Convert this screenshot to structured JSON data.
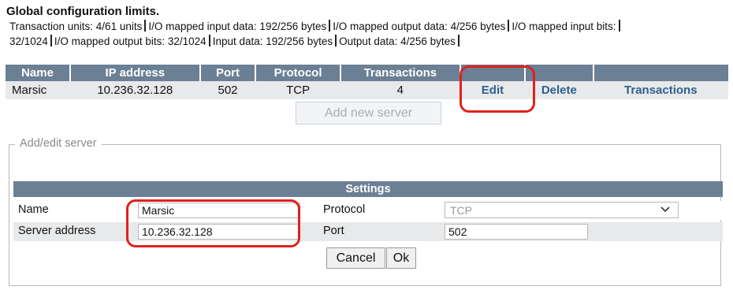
{
  "limits": {
    "title": "Global configuration limits.",
    "segments": [
      "Transaction units: 4/61 units",
      "I/O mapped input data: 192/256 bytes",
      "I/O mapped output data: 4/256 bytes",
      "I/O mapped input bits:",
      "32/1024",
      "I/O mapped output bits: 32/1024",
      "Input data: 192/256 bytes",
      "Output data: 4/256 bytes"
    ]
  },
  "servers_table": {
    "headers": [
      "Name",
      "IP address",
      "Port",
      "Protocol",
      "Transactions",
      "",
      "",
      ""
    ],
    "rows": [
      {
        "name": "Marsic",
        "ip": "10.236.32.128",
        "port": "502",
        "protocol": "TCP",
        "transactions": "4",
        "edit": "Edit",
        "delete": "Delete",
        "transactions_link": "Transactions"
      }
    ]
  },
  "add_server_label": "Add new server",
  "add_edit": {
    "legend": "Add/edit server",
    "settings_header": "Settings",
    "name_label": "Name",
    "name_value": "Marsic",
    "server_address_label": "Server address",
    "server_address_value": "10.236.32.128",
    "protocol_label": "Protocol",
    "protocol_value": "TCP",
    "port_label": "Port",
    "port_value": "502",
    "cancel_label": "Cancel",
    "ok_label": "Ok"
  },
  "colors": {
    "header_bg": "#6b7f95",
    "row_bg": "#e8e9ea",
    "link": "#2f5f8f",
    "highlight": "#e0211e"
  },
  "icons": {
    "protocol_dropdown": "chevron-down-icon"
  }
}
